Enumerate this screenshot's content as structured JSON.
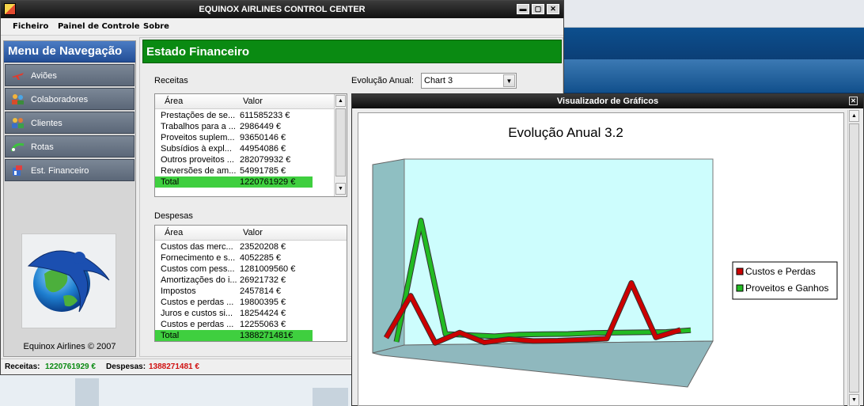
{
  "window": {
    "title": "EQUINOX AIRLINES CONTROL CENTER",
    "min": "▬",
    "max": "▢",
    "close": "✕"
  },
  "menu": {
    "items": [
      "Ficheiro",
      "Painel de Controle",
      "Sobre"
    ]
  },
  "sidebar": {
    "title": "Menu de Navegação",
    "items": [
      {
        "label": "Aviões",
        "icon": "airplane-icon"
      },
      {
        "label": "Colaboradores",
        "icon": "people-icon"
      },
      {
        "label": "Clientes",
        "icon": "clients-icon"
      },
      {
        "label": "Rotas",
        "icon": "routes-icon"
      },
      {
        "label": "Est. Financeiro",
        "icon": "finance-icon"
      }
    ],
    "footer": "Equinox Airlines © 2007"
  },
  "content": {
    "title": "Estado Financeiro",
    "receitas_label": "Receitas",
    "despesas_label": "Despesas",
    "evolucao_label": "Evolução Anual:",
    "evolucao_value": "Chart 3",
    "col_area": "Área",
    "col_valor": "Valor",
    "receitas": [
      {
        "area": "Prestações de se...",
        "valor": "611585233 €"
      },
      {
        "area": "Trabalhos para a ...",
        "valor": "2986449 €"
      },
      {
        "area": "Proveitos suplem...",
        "valor": "93650146 €"
      },
      {
        "area": "Subsídios à expl...",
        "valor": "44954086 €"
      },
      {
        "area": "Outros proveitos ...",
        "valor": "282079932 €"
      },
      {
        "area": "Reversões de am...",
        "valor": "54991785 €"
      }
    ],
    "receitas_total": {
      "area": "Total",
      "valor": "1220761929 €"
    },
    "despesas": [
      {
        "area": "Custos das merc...",
        "valor": "23520208 €"
      },
      {
        "area": "Fornecimento e s...",
        "valor": "4052285 €"
      },
      {
        "area": "Custos com pess...",
        "valor": "1281009560 €"
      },
      {
        "area": "Amortizações do i...",
        "valor": "26921732 €"
      },
      {
        "area": "Impostos",
        "valor": "2457814 €"
      },
      {
        "area": "Custos e perdas ...",
        "valor": "19800395 €"
      },
      {
        "area": "Juros e custos si...",
        "valor": "18254424 €"
      },
      {
        "area": "Custos e perdas ...",
        "valor": "12255063 €"
      }
    ],
    "despesas_total": {
      "area": "Total",
      "valor": "1388271481€"
    }
  },
  "status": {
    "receitas_label": "Receitas:",
    "receitas_value": "1220761929 €",
    "despesas_label": "Despesas:",
    "despesas_value": "1388271481 €",
    "receitas_color": "#0a8a12",
    "despesas_color": "#d01010"
  },
  "viewer": {
    "title": "Visualizador de Gráficos"
  },
  "chart_data": {
    "type": "line",
    "title": "Evolução Anual 3.2",
    "xlabel": "",
    "ylabel": "",
    "grid": false,
    "legend_position": "right",
    "series": [
      {
        "name": "Custos e Perdas",
        "color": "#cc0000",
        "values": [
          10,
          38,
          4,
          10,
          2,
          3,
          0.5,
          -0.5,
          -1,
          -1.5,
          36,
          -3,
          1
        ]
      },
      {
        "name": "Proveitos e Ganhos",
        "color": "#22bb22",
        "values": [
          5,
          88,
          8,
          6,
          4,
          4,
          3,
          2,
          1.5,
          0.5,
          -0.5,
          -1.5,
          -1.5
        ]
      }
    ]
  }
}
